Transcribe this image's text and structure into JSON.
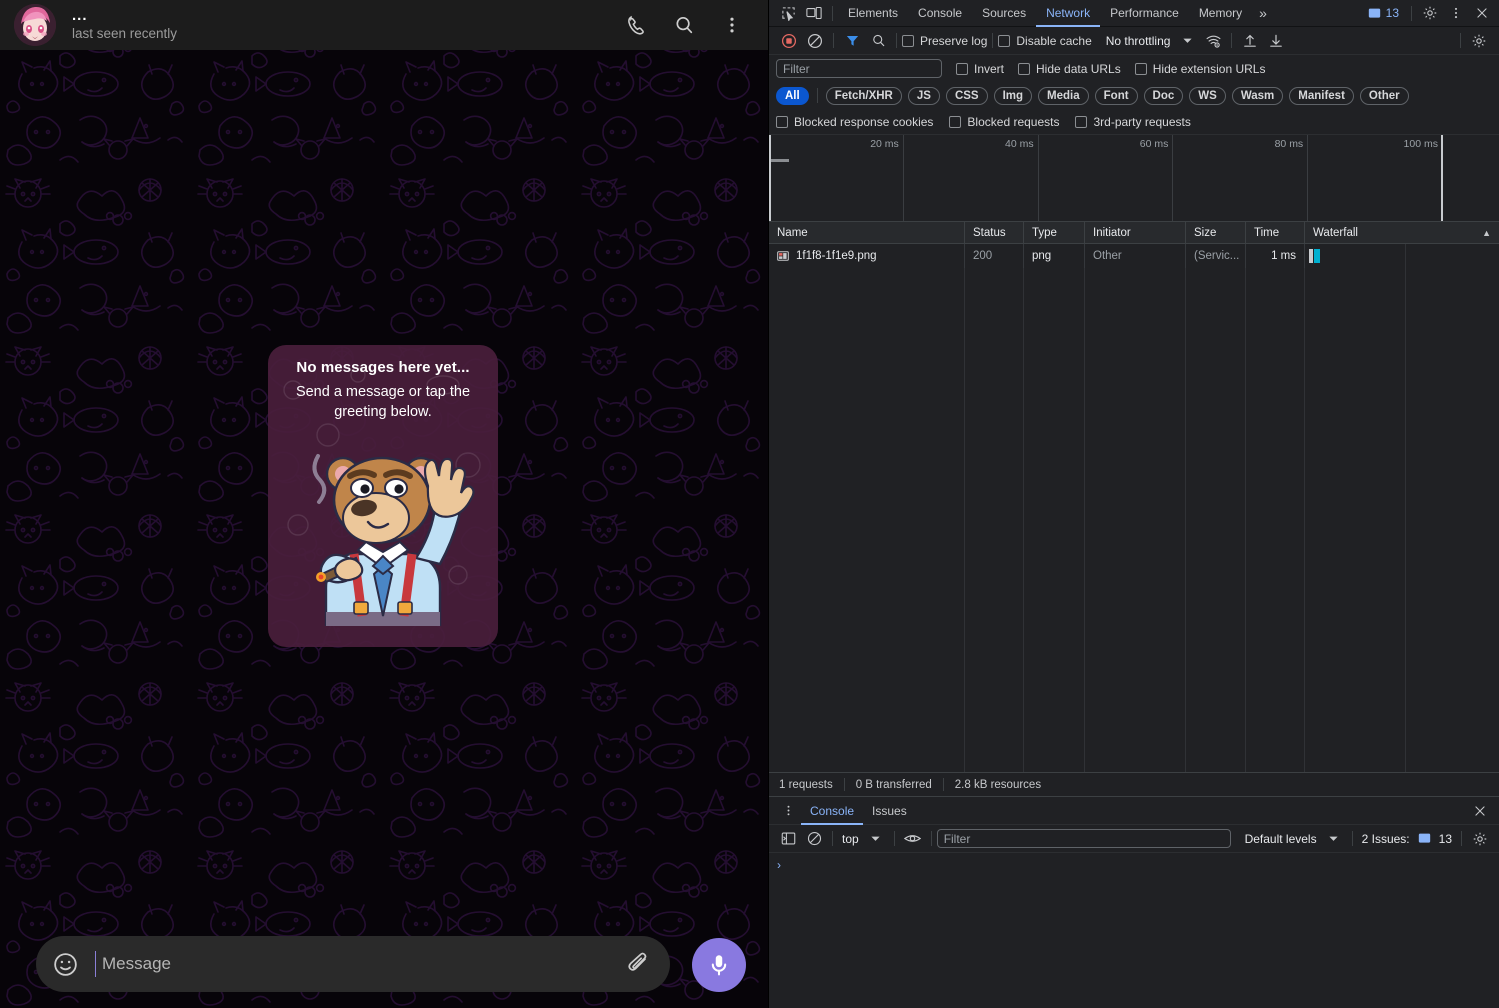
{
  "telegram": {
    "header": {
      "avatar": "avatar-anime-pink",
      "name": "...",
      "status": "last seen recently",
      "call_icon": "phone-icon",
      "search_icon": "search-icon",
      "menu_icon": "kebab-menu-icon"
    },
    "empty_bubble": {
      "title": "No messages here yet...",
      "subtitle": "Send a message or tap the greeting below.",
      "sticker": "bear-waving-sticker"
    },
    "composer": {
      "emoji_icon": "emoji-smiley-icon",
      "placeholder": "Message",
      "value": "",
      "attach_icon": "paperclip-icon",
      "mic_icon": "microphone-icon",
      "mic_color": "#8979e0"
    }
  },
  "devtools": {
    "tabbar": {
      "inspect_icon": "inspect-element-icon",
      "device_icon": "device-toolbar-icon",
      "tabs": [
        {
          "label": "Elements",
          "active": false
        },
        {
          "label": "Console",
          "active": false
        },
        {
          "label": "Sources",
          "active": false
        },
        {
          "label": "Network",
          "active": true
        },
        {
          "label": "Performance",
          "active": false
        },
        {
          "label": "Memory",
          "active": false
        }
      ],
      "more_tabs": "»",
      "issues_count": "13",
      "issues_icon": "issues-message-icon",
      "settings_icon": "gear-icon",
      "kebab_icon": "kebab-menu-icon",
      "close_icon": "close-icon",
      "accent": "#8ab4f8"
    },
    "network_toolbar": {
      "record_icon": "record-stop-icon",
      "record_color": "#e46962",
      "clear_icon": "clear-icon",
      "filter_icon": "filter-funnel-icon",
      "filter_active_color": "#8ab4f8",
      "search_icon": "search-icon",
      "preserve_log": {
        "label": "Preserve log",
        "checked": false
      },
      "disable_cache": {
        "label": "Disable cache",
        "checked": false
      },
      "throttling": "No throttling",
      "throttle_caret": "▾",
      "wifi_icon": "network-conditions-icon",
      "import_icon": "import-har-icon",
      "export_icon": "export-har-icon",
      "settings_icon": "gear-icon"
    },
    "filter_row": {
      "placeholder": "Filter",
      "value": "",
      "invert": {
        "label": "Invert",
        "checked": false
      },
      "hide_data_urls": {
        "label": "Hide data URLs",
        "checked": false
      },
      "hide_extension_urls": {
        "label": "Hide extension URLs",
        "checked": false
      }
    },
    "type_filters": [
      {
        "label": "All",
        "selected": true
      },
      {
        "label": "Fetch/XHR",
        "selected": false
      },
      {
        "label": "JS",
        "selected": false
      },
      {
        "label": "CSS",
        "selected": false
      },
      {
        "label": "Img",
        "selected": false
      },
      {
        "label": "Media",
        "selected": false
      },
      {
        "label": "Font",
        "selected": false
      },
      {
        "label": "Doc",
        "selected": false
      },
      {
        "label": "WS",
        "selected": false
      },
      {
        "label": "Wasm",
        "selected": false
      },
      {
        "label": "Manifest",
        "selected": false
      },
      {
        "label": "Other",
        "selected": false
      }
    ],
    "block_row": [
      {
        "label": "Blocked response cookies",
        "checked": false
      },
      {
        "label": "Blocked requests",
        "checked": false
      },
      {
        "label": "3rd-party requests",
        "checked": false
      }
    ],
    "overview": {
      "ticks": [
        "20 ms",
        "40 ms",
        "60 ms",
        "80 ms",
        "100 ms"
      ]
    },
    "table": {
      "columns": [
        "Name",
        "Status",
        "Type",
        "Initiator",
        "Size",
        "Time",
        "Waterfall"
      ],
      "sort_indicator": "▲",
      "rows": [
        {
          "icon": "image-file-icon",
          "name": "1f1f8-1f1e9.png",
          "status": "200",
          "type": "png",
          "initiator": "Other",
          "size": "(Servic...",
          "time": "1 ms",
          "waterfall_color": "#00b0d0"
        }
      ]
    },
    "status_bar": {
      "requests": "1 requests",
      "transferred": "0 B transferred",
      "resources": "2.8 kB resources"
    },
    "console_drawer": {
      "kebab_icon": "kebab-menu-icon",
      "tabs": [
        {
          "label": "Console",
          "active": true
        },
        {
          "label": "Issues",
          "active": false
        }
      ],
      "close_icon": "close-icon",
      "sidebar_icon": "console-sidebar-icon",
      "clear_icon": "clear-icon",
      "context": "top",
      "context_caret": "▾",
      "eye_icon": "live-expression-eye-icon",
      "filter_placeholder": "Filter",
      "filter_value": "",
      "levels": "Default levels",
      "levels_caret": "▾",
      "issues_label": "2 Issues:",
      "issues_count": "13",
      "settings_icon": "gear-icon",
      "prompt": "›"
    }
  }
}
